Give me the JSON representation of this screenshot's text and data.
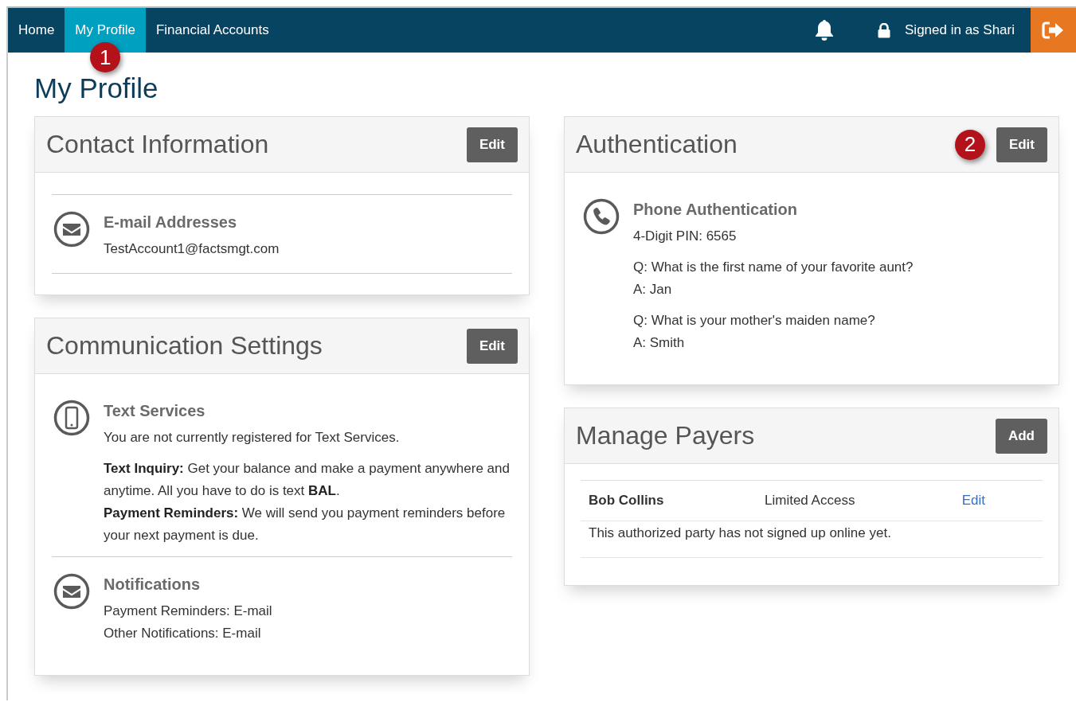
{
  "nav": {
    "items": [
      {
        "label": "Home",
        "selected": false
      },
      {
        "label": "My Profile",
        "selected": true,
        "callout": "1"
      },
      {
        "label": "Financial Accounts",
        "selected": false
      }
    ],
    "user_label": "Signed in as Shari"
  },
  "page_title": "My Profile",
  "columns": [
    [
      {
        "kind": "framed-list",
        "title": "Contact Information",
        "button": "Edit",
        "sections": [
          {
            "kind": "email",
            "heading": "E-mail Addresses",
            "paragraphs": [
              [
                "TestAccount1@factsmgt.com"
              ]
            ]
          }
        ]
      },
      {
        "kind": "list",
        "title": "Communication Settings",
        "button": "Edit",
        "sections": [
          {
            "kind": "mobile",
            "heading": "Text Services",
            "paragraphs": [
              [
                "You are not currently registered for Text Services."
              ],
              [
                "**Text Inquiry:** Get your balance and make a payment anywhere and anytime. All you have to do is text **BAL**.",
                "**Payment Reminders:** We will send you payment reminders before your next payment is due."
              ]
            ]
          },
          {
            "kind": "email",
            "heading": "Notifications",
            "paragraphs": [
              [
                "Payment Reminders: E-mail",
                "Other Notifications: E-mail"
              ]
            ]
          }
        ]
      }
    ],
    [
      {
        "kind": "list",
        "title": "Authentication",
        "button": "Edit",
        "callout": "2",
        "sections": [
          {
            "kind": "phone",
            "heading": "Phone Authentication",
            "paragraphs": [
              [
                "4-Digit PIN: 6565"
              ],
              [
                "Q: What is the first name of your favorite aunt?",
                "A: Jan"
              ],
              [
                "Q: What is your mother's maiden name?",
                "A: Smith"
              ]
            ]
          }
        ]
      },
      {
        "kind": "payers",
        "title": "Manage Payers",
        "button": "Add",
        "rows": [
          {
            "name": "Bob Collins",
            "access": "Limited Access",
            "action": "Edit",
            "note": "This authorized party has not signed up online yet."
          }
        ]
      }
    ]
  ]
}
